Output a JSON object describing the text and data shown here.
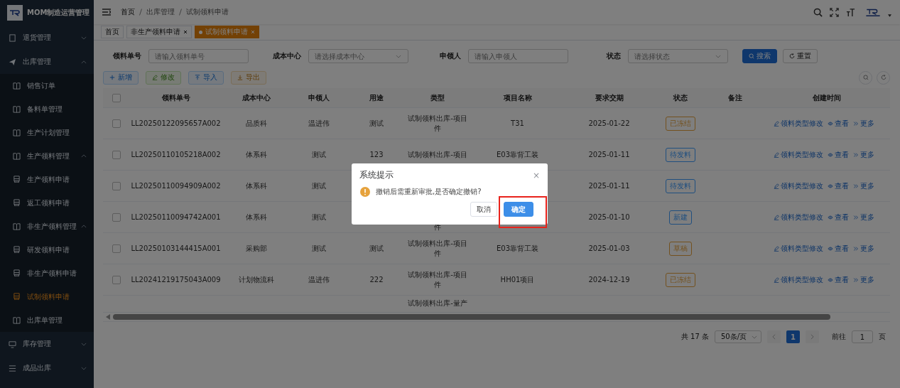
{
  "app": {
    "title": "MOM制造运营管理"
  },
  "sidebar": {
    "items": [
      {
        "label": "退货管理",
        "kind": "doc",
        "expanded": false,
        "selected": false
      },
      {
        "label": "出库管理",
        "kind": "send",
        "expanded": true,
        "selected": false,
        "children": [
          {
            "label": "销售订单",
            "kind": "book",
            "selected": false
          },
          {
            "label": "备料单管理",
            "kind": "book",
            "selected": false
          },
          {
            "label": "生产计划管理",
            "kind": "book",
            "selected": false
          },
          {
            "label": "生产领料管理",
            "kind": "book",
            "expanded": true,
            "selected": false,
            "children": [
              {
                "label": "生产领料申请",
                "kind": "bus",
                "selected": false
              },
              {
                "label": "返工领料申请",
                "kind": "bus",
                "selected": false
              }
            ]
          },
          {
            "label": "非生产领料管理",
            "kind": "book",
            "expanded": true,
            "selected": false,
            "children": [
              {
                "label": "研发领料申请",
                "kind": "bus",
                "selected": false
              },
              {
                "label": "非生产领料申请",
                "kind": "bus",
                "selected": false
              },
              {
                "label": "试制领料申请",
                "kind": "bus",
                "selected": true
              }
            ]
          },
          {
            "label": "出库单管理",
            "kind": "book",
            "selected": false
          }
        ]
      },
      {
        "label": "库存管理",
        "kind": "monitor",
        "expanded": false,
        "selected": false
      },
      {
        "label": "成品出库",
        "kind": "list",
        "expanded": false,
        "selected": false
      }
    ]
  },
  "breadcrumb": [
    "首页",
    "出库管理",
    "试制领料申请"
  ],
  "tags": [
    {
      "label": "首页",
      "closable": false,
      "selected": false
    },
    {
      "label": "非生产领料申请",
      "closable": true,
      "selected": false
    },
    {
      "label": "试制领料申请",
      "closable": true,
      "selected": true
    }
  ],
  "search": {
    "fields": [
      {
        "label": "领料单号",
        "placeholder": "请输入领料单号",
        "kind": "input"
      },
      {
        "label": "成本中心",
        "placeholder": "请选择成本中心",
        "kind": "select"
      },
      {
        "label": "申领人",
        "placeholder": "请输入申领人",
        "kind": "input"
      },
      {
        "label": "状态",
        "placeholder": "请选择状态",
        "kind": "select"
      }
    ],
    "buttons": [
      {
        "label": "搜索",
        "kind": "primary"
      },
      {
        "label": "重置",
        "kind": "plain"
      }
    ]
  },
  "toolbar": [
    {
      "label": "新增",
      "kind": "add"
    },
    {
      "label": "修改",
      "kind": "edit"
    },
    {
      "label": "导入",
      "kind": "import"
    },
    {
      "label": "导出",
      "kind": "export"
    }
  ],
  "table": {
    "header_checked": false,
    "columns": [
      "领料单号",
      "成本中心",
      "申领人",
      "用途",
      "类型",
      "项目名称",
      "要求交期",
      "状态",
      "备注",
      "创建时间"
    ],
    "rows": [
      {
        "checked": false,
        "cells": [
          "LL20250122095657A002",
          "品质科",
          "温进伟",
          "测试",
          "试制领料出库-项目件",
          "T31",
          "2025-01-22"
        ],
        "status": {
          "label": "已冻结",
          "color": "#73511e"
        },
        "actions": [
          "领料类型修改",
          "查看",
          "更多"
        ]
      },
      {
        "checked": false,
        "cells": [
          "LL20250110105218A002",
          "体系科",
          "测试",
          "123",
          "试制领料出库-项目",
          "E03靠背工装",
          "2025-01-11"
        ],
        "status": {
          "label": "待发料",
          "color": "#204f7f"
        },
        "actions": [
          "领料类型修改",
          "查看",
          "更多"
        ]
      },
      {
        "checked": false,
        "cells": [
          "LL20250110094909A002",
          "体系科",
          "测试",
          "",
          "",
          "",
          "2025-01-11"
        ],
        "status": {
          "label": "待发料",
          "color": "#204f7f"
        },
        "actions": [
          "领料类型修改",
          "查看",
          "更多"
        ]
      },
      {
        "checked": false,
        "cells": [
          "LL20250110094742A001",
          "体系科",
          "测试",
          "",
          "件",
          "",
          "2025-01-10"
        ],
        "status": {
          "label": "新建",
          "color": "#204f7f"
        },
        "actions": [
          "领料类型修改",
          "查看",
          "更多"
        ]
      },
      {
        "checked": false,
        "cells": [
          "LL20250103144415A001",
          "采购部",
          "测试",
          "测试",
          "试制领料出库-项目件",
          "E03靠背工装",
          "2025-01-03"
        ],
        "status": {
          "label": "草稿",
          "color": "#73511e"
        },
        "actions": [
          "领料类型修改",
          "查看",
          "更多"
        ]
      },
      {
        "checked": false,
        "cells": [
          "LL20241219175043A009",
          "计划物流科",
          "温进伟",
          "222",
          "试制领料出库-项目件",
          "HH01项目",
          "2024-12-19"
        ],
        "status": {
          "label": "已冻结",
          "color": "#73511e"
        },
        "actions": [
          "领料类型修改",
          "查看",
          "更多"
        ]
      }
    ],
    "partial_row": {
      "type": "试制领料出库-量产"
    }
  },
  "pagination": {
    "total": "共 17 条",
    "page_size": "50条/页",
    "pages": [
      {
        "label": "1",
        "selected": true
      }
    ],
    "goto_label": "前往",
    "goto_value": "1",
    "goto_suffix": "页"
  },
  "dialog": {
    "title": "系统提示",
    "close": "×",
    "message": "撤销后需重新审批,是否确定撤销?",
    "buttons": [
      {
        "label": "取消",
        "kind": "plain"
      },
      {
        "label": "确定",
        "kind": "primary",
        "highlighted": true
      }
    ]
  }
}
